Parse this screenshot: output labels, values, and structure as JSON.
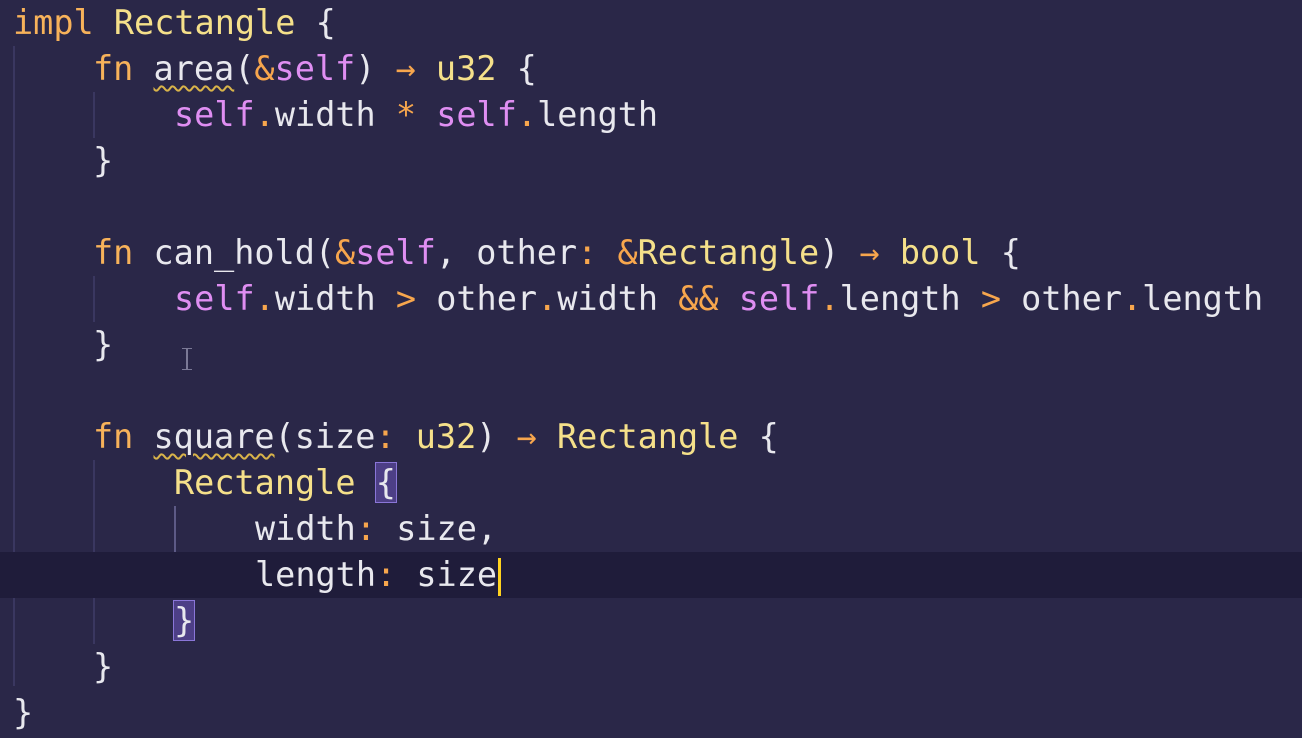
{
  "theme": {
    "background": "#2a2748",
    "current_line": "#1f1c3a",
    "keyword": "#f7b25a",
    "type": "#f5e08a",
    "self": "#df8ef2",
    "operator": "#f7a64d",
    "text": "#e8e8ee",
    "caret": "#ffd21f"
  },
  "editor": {
    "lines": [
      {
        "t": [
          "impl",
          " ",
          "Rectangle",
          " ",
          "{"
        ]
      },
      {
        "t": [
          "fn",
          " ",
          "area",
          "(",
          "&",
          "self",
          ")",
          " ",
          "→",
          " ",
          "u32",
          " ",
          "{"
        ]
      },
      {
        "t": [
          "self",
          ".",
          "width",
          " ",
          "*",
          " ",
          "self",
          ".",
          "length"
        ]
      },
      {
        "t": [
          "}"
        ]
      },
      {
        "t": []
      },
      {
        "t": [
          "fn",
          " ",
          "can_hold",
          "(",
          "&",
          "self",
          ", ",
          "other",
          ":",
          " ",
          "&",
          "Rectangle",
          ")",
          " ",
          "→",
          " ",
          "bool",
          " ",
          "{"
        ]
      },
      {
        "t": [
          "self",
          ".",
          "width",
          " ",
          ">",
          " ",
          "other",
          ".",
          "width",
          " ",
          "&&",
          " ",
          "self",
          ".",
          "length",
          " ",
          ">",
          " ",
          "other",
          ".",
          "length"
        ]
      },
      {
        "t": [
          "}"
        ]
      },
      {
        "t": []
      },
      {
        "t": [
          "fn",
          " ",
          "square",
          "(",
          "size",
          ":",
          " ",
          "u32",
          ")",
          " ",
          "→",
          " ",
          "Rectangle",
          " ",
          "{"
        ]
      },
      {
        "t": [
          "Rectangle",
          " ",
          "{"
        ]
      },
      {
        "t": [
          "width",
          ":",
          " ",
          "size",
          ","
        ]
      },
      {
        "t": [
          "length",
          ":",
          " ",
          "size"
        ]
      },
      {
        "t": [
          "}"
        ]
      },
      {
        "t": [
          "}"
        ]
      },
      {
        "t": [
          "}"
        ]
      }
    ]
  }
}
